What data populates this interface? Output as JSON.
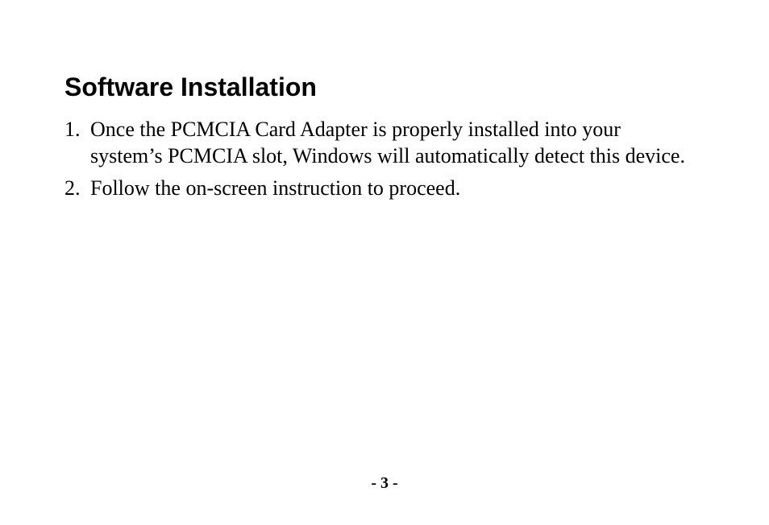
{
  "heading": "Software Installation",
  "list": {
    "items": [
      {
        "marker": "1.",
        "text": "Once the PCMCIA Card Adapter is properly installed into your system’s PCMCIA slot, Windows will automatically detect this device."
      },
      {
        "marker": "2.",
        "text": "Follow the on-screen instruction to proceed."
      }
    ]
  },
  "page_number": "- 3 -"
}
